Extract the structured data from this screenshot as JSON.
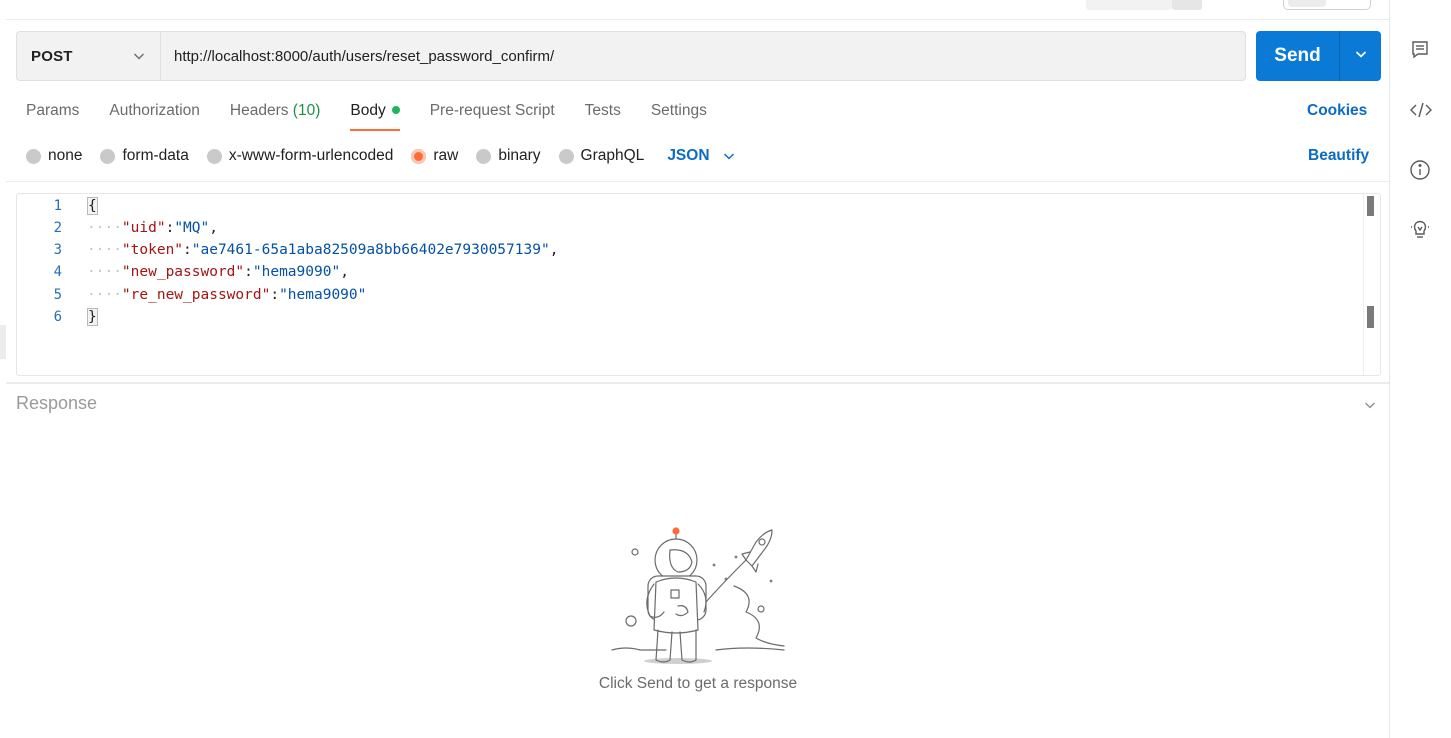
{
  "request": {
    "method": "POST",
    "url": "http://localhost:8000/auth/users/reset_password_confirm/"
  },
  "send": {
    "label": "Send",
    "dropdown_icon": "chevron-down-icon"
  },
  "tabs": [
    {
      "label": "Params"
    },
    {
      "label": "Authorization"
    },
    {
      "label": "Headers",
      "count": "(10)"
    },
    {
      "label": "Body",
      "active": true,
      "indicator": "green-dot"
    },
    {
      "label": "Pre-request Script"
    },
    {
      "label": "Tests"
    },
    {
      "label": "Settings"
    }
  ],
  "cookies_label": "Cookies",
  "body_types": [
    {
      "label": "none",
      "checked": false
    },
    {
      "label": "form-data",
      "checked": false
    },
    {
      "label": "x-www-form-urlencoded",
      "checked": false
    },
    {
      "label": "raw",
      "checked": true
    },
    {
      "label": "binary",
      "checked": false
    },
    {
      "label": "GraphQL",
      "checked": false
    }
  ],
  "raw_language": "JSON",
  "beautify_label": "Beautify",
  "editor": {
    "line_numbers": [
      "1",
      "2",
      "3",
      "4",
      "5",
      "6"
    ],
    "open_brace": "{",
    "close_brace": "}",
    "entries": [
      {
        "key": "\"uid\"",
        "value": "\"MQ\"",
        "comma": ","
      },
      {
        "key": "\"token\"",
        "value": "\"ae7461-65a1aba82509a8bb66402e7930057139\"",
        "comma": ","
      },
      {
        "key": "\"new_password\"",
        "value": "\"hema9090\"",
        "comma": ","
      },
      {
        "key": "\"re_new_password\"",
        "value": "\"hema9090\"",
        "comma": ""
      }
    ],
    "indent_guide": "····",
    "colon": ":"
  },
  "response": {
    "title": "Response",
    "empty_message": "Click Send to get a response"
  },
  "right_sidebar": [
    "comment-icon",
    "code-icon",
    "info-icon",
    "lightbulb-icon"
  ],
  "colors": {
    "accent_orange": "#ff6c37",
    "send_blue": "#0b7ad6",
    "link_blue": "#0b6cc4",
    "active_dot_green": "#1fb35b"
  }
}
